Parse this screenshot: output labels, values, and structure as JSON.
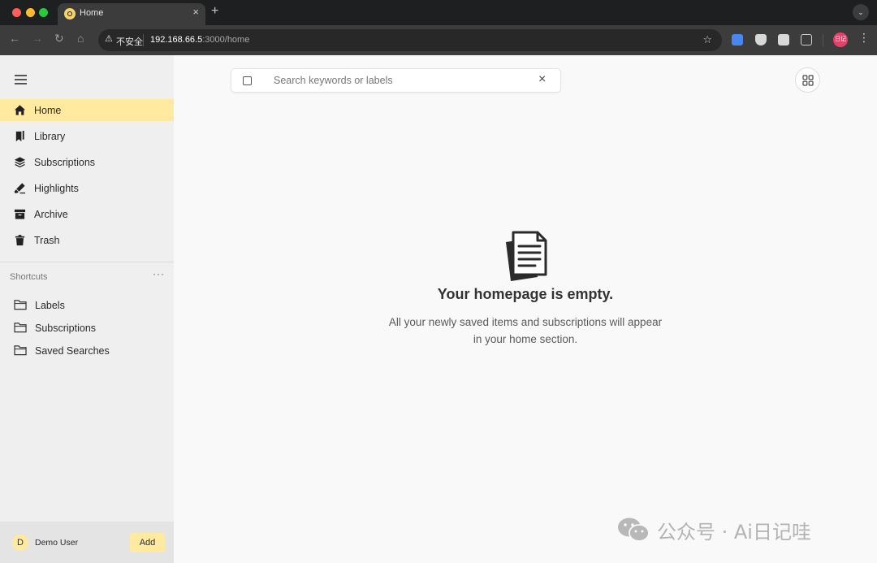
{
  "browser": {
    "tab_title": "Home",
    "tab_close": "×",
    "new_tab": "+",
    "tab_menu": "⌄",
    "back": "←",
    "forward": "→",
    "reload": "↻",
    "home": "⌂",
    "security_icon": "⚠",
    "security_label": "不安全",
    "url_host": "192.168.66.5",
    "url_rest": ":3000/home",
    "bookmark_star": "☆",
    "profile_label": "日记",
    "menu": "⋮"
  },
  "sidebar": {
    "nav": [
      {
        "label": "Home",
        "icon": "home-icon",
        "active": true
      },
      {
        "label": "Library",
        "icon": "bookmarks-icon",
        "active": false
      },
      {
        "label": "Subscriptions",
        "icon": "stack-icon",
        "active": false
      },
      {
        "label": "Highlights",
        "icon": "highlighter-icon",
        "active": false
      },
      {
        "label": "Archive",
        "icon": "archive-box-icon",
        "active": false
      },
      {
        "label": "Trash",
        "icon": "trash-icon",
        "active": false
      }
    ],
    "shortcuts_title": "Shortcuts",
    "shortcuts_more": "···",
    "shortcuts": [
      {
        "label": "Labels",
        "icon": "folder-icon"
      },
      {
        "label": "Subscriptions",
        "icon": "folder-icon"
      },
      {
        "label": "Saved Searches",
        "icon": "folder-icon"
      }
    ],
    "user": {
      "initial": "D",
      "name": "Demo User",
      "add_label": "Add"
    }
  },
  "search": {
    "placeholder": "Search keywords or labels",
    "clear": "×"
  },
  "empty_state": {
    "title": "Your homepage is empty.",
    "line1": "All your newly saved items and subscriptions will appear",
    "line2": "in your home section."
  },
  "watermark": {
    "text": "公众号 · Ai日记哇"
  },
  "colors": {
    "accent": "#ffea9f",
    "sidebar_bg": "#efefef",
    "main_bg": "#f9f9f9"
  }
}
